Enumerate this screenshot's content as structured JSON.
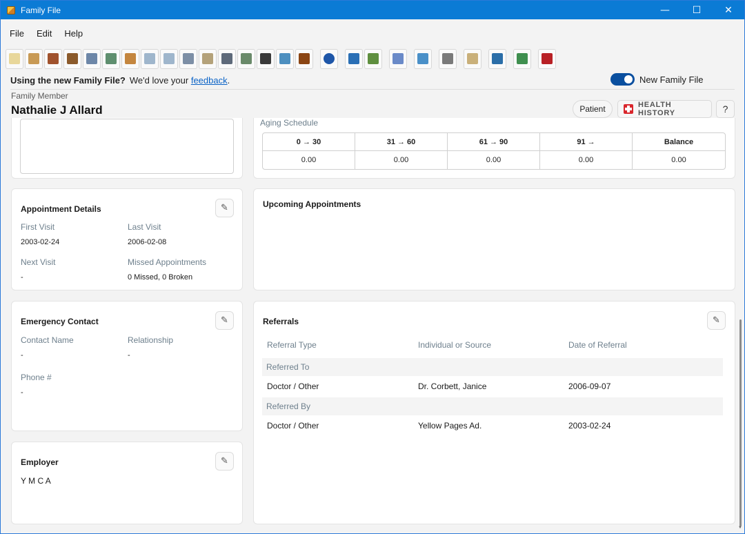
{
  "window": {
    "title": "Family File",
    "controls": {
      "minimize": "—",
      "maximize": "☐",
      "close": "✕"
    }
  },
  "menu": [
    "File",
    "Edit",
    "Help"
  ],
  "toolbar": {
    "icons": [
      {
        "name": "tooth-icon",
        "color": "#e8d79a"
      },
      {
        "name": "chart-notebook-icon",
        "color": "#c89a55"
      },
      {
        "name": "books-icon",
        "color": "#a0522d"
      },
      {
        "name": "dentist-chair-icon",
        "color": "#8b5a2b"
      },
      {
        "name": "id-card-icon",
        "color": "#6d87a8"
      },
      {
        "name": "globe-icon",
        "color": "#5f8f6f"
      },
      {
        "name": "bandage-icon",
        "color": "#c4863f"
      },
      {
        "name": "blank-form-icon",
        "color": "#9fb6cc"
      },
      {
        "name": "ledger-icon",
        "color": "#9fb6cc"
      },
      {
        "name": "payment-card-icon",
        "color": "#7d8fa6"
      },
      {
        "name": "camera-icon",
        "color": "#b4a27a"
      },
      {
        "name": "document-list-icon",
        "color": "#5e6a7a"
      },
      {
        "name": "report-icon",
        "color": "#6a8a6a"
      },
      {
        "name": "prescription-icon",
        "color": "#3a3a3a"
      },
      {
        "name": "rubber-stamp-icon",
        "color": "#4d8fbf"
      },
      {
        "name": "bookshelf-icon",
        "color": "#8b4513"
      },
      {
        "name": "info-icon",
        "color": "#1e56a8"
      },
      {
        "name": "provider-icon",
        "color": "#2a6fb5"
      },
      {
        "name": "family-icon",
        "color": "#5f8f3f"
      },
      {
        "name": "referral-link-icon",
        "color": "#6a8ac8"
      },
      {
        "name": "schedule-clock-icon",
        "color": "#4a90c8"
      },
      {
        "name": "printer-icon",
        "color": "#7a7a7a"
      },
      {
        "name": "note-icon",
        "color": "#c9b07a"
      },
      {
        "name": "doctor-icon",
        "color": "#2b6ea8"
      },
      {
        "name": "phone-contact-icon",
        "color": "#3f8f4f"
      },
      {
        "name": "open-book-icon",
        "color": "#b82025"
      }
    ]
  },
  "feedback": {
    "bold_text": "Using the new Family File?",
    "text": "We'd love your",
    "link": "feedback",
    "suffix": "."
  },
  "toggle": {
    "label": "New Family File",
    "on": true
  },
  "family_member": {
    "label": "Family Member",
    "name": "Nathalie J Allard"
  },
  "header_buttons": {
    "patient": "Patient",
    "health_history": "HEALTH HISTORY",
    "help": "?"
  },
  "aging": {
    "label": "Aging Schedule",
    "columns": [
      "0  →  30",
      "31  →  60",
      "61  →  90",
      "91  →",
      "Balance"
    ],
    "values": [
      "0.00",
      "0.00",
      "0.00",
      "0.00",
      "0.00"
    ]
  },
  "appointment_details": {
    "title": "Appointment Details",
    "first_visit_label": "First Visit",
    "first_visit": "2003-02-24",
    "last_visit_label": "Last Visit",
    "last_visit": "2006-02-08",
    "next_visit_label": "Next Visit",
    "next_visit": "-",
    "missed_label": "Missed Appointments",
    "missed": "0 Missed, 0 Broken"
  },
  "upcoming": {
    "title": "Upcoming Appointments"
  },
  "emergency_contact": {
    "title": "Emergency Contact",
    "contact_name_label": "Contact Name",
    "contact_name": "-",
    "relationship_label": "Relationship",
    "relationship": "-",
    "phone_label": "Phone #",
    "phone": "-"
  },
  "employer": {
    "title": "Employer",
    "value": "Y M C A"
  },
  "referrals": {
    "title": "Referrals",
    "headers": [
      "Referral Type",
      "Individual or Source",
      "Date of Referral"
    ],
    "groups": [
      {
        "label": "Referred To",
        "rows": [
          [
            "Doctor / Other",
            "Dr. Corbett, Janice",
            "2006-09-07"
          ]
        ]
      },
      {
        "label": "Referred By",
        "rows": [
          [
            "Doctor / Other",
            "Yellow Pages Ad.",
            "2003-02-24"
          ]
        ]
      }
    ]
  }
}
